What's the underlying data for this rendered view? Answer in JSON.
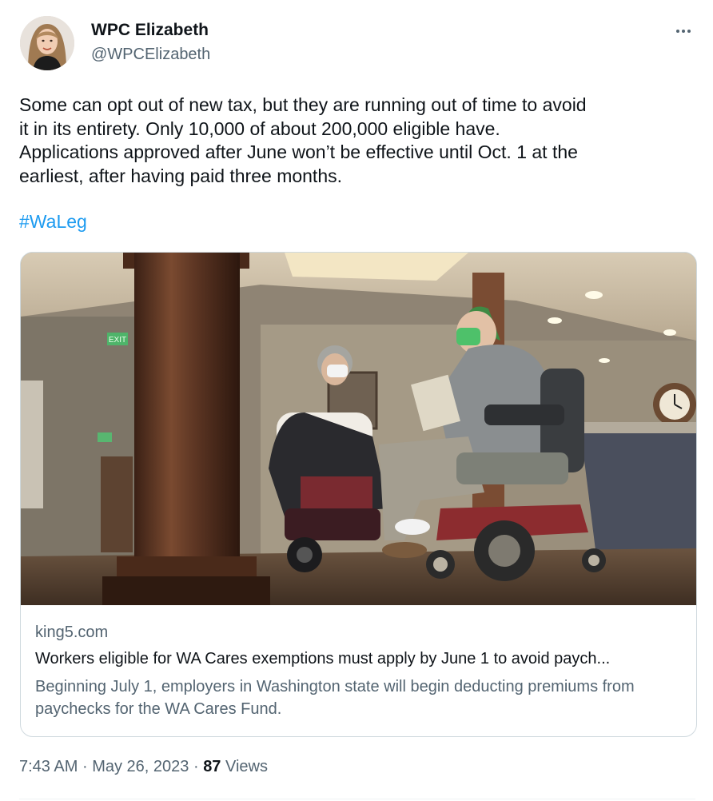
{
  "author": {
    "name": "WPC Elizabeth",
    "handle": "@WPCElizabeth"
  },
  "tweet": {
    "text_lines": [
      "Some can opt out of new tax, but they are running out of time to avoid",
      "it in its entirety. Only 10,000 of about 200,000 eligible have.",
      "Applications approved after June won’t be effective until Oct. 1 at the",
      "earliest, after having paid three months."
    ],
    "hashtag": "#WaLeg"
  },
  "card": {
    "image_icon": "photo-two-people-power-wheelchairs-masks",
    "exit_sign": "EXIT",
    "domain": "king5.com",
    "title": "Workers eligible for WA Cares exemptions must apply by June 1 to avoid paych...",
    "description": "Beginning July 1, employers in Washington state will begin deducting premiums from paychecks for the WA Cares Fund."
  },
  "meta": {
    "time": "7:43 AM",
    "separator": "·",
    "date": "May 26, 2023",
    "views_count": "87",
    "views_label": "Views"
  },
  "colors": {
    "text": "#0f1419",
    "secondary": "#536471",
    "link": "#1d9bf0",
    "border": "#cfd9de"
  },
  "icons": {
    "more": "more-horizontal-icon"
  }
}
